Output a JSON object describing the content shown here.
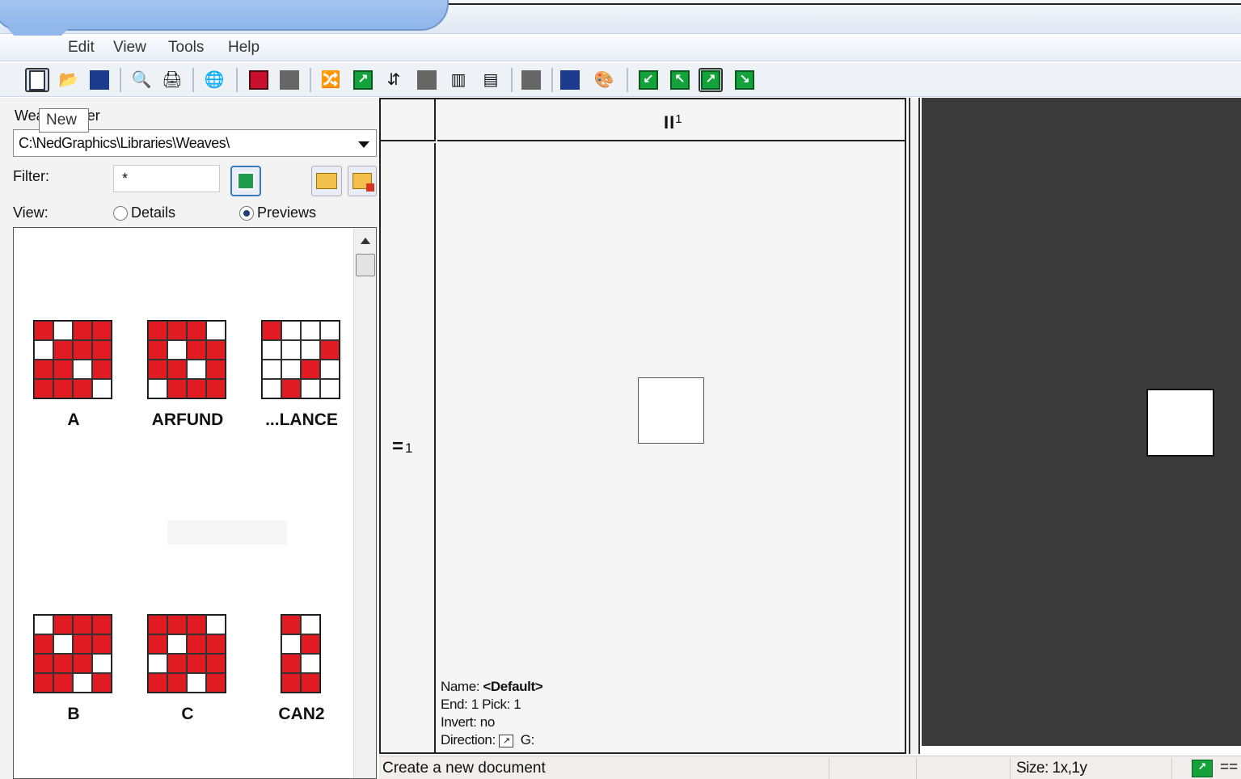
{
  "menu": [
    "Edit",
    "View",
    "Tools",
    "Help"
  ],
  "toolbar_icons": [
    "new-icon",
    "open-icon",
    "save-icon",
    "print-preview-icon",
    "print-icon",
    "web-icon",
    "grid-icon",
    "list-icon",
    "color-swap-icon",
    "arrow-icon",
    "scale-icon",
    "block-icon",
    "palette-icon",
    "column-icon",
    "copy-icon",
    "pattern-icon",
    "colors-icon",
    "direction-nw-icon",
    "direction-ne-icon",
    "direction-se-icon",
    "direction-sw-icon"
  ],
  "tooltip": "New",
  "left": {
    "folder_label": "Weave folder",
    "folder_path": "C:\\NedGraphics\\Libraries\\Weaves\\",
    "filter_label": "Filter:",
    "filter_value": "*",
    "view_label": "View:",
    "view_options": [
      "Details",
      "Previews"
    ],
    "view_selected": "Previews"
  },
  "weaves": [
    {
      "name": "A",
      "cells": [
        "r",
        "w",
        "r",
        "r",
        "w",
        "r",
        "r",
        "r",
        "r",
        "r",
        "w",
        "r",
        "r",
        "r",
        "r",
        "w"
      ]
    },
    {
      "name": "ARFUND",
      "cells": [
        "r",
        "r",
        "r",
        "w",
        "r",
        "w",
        "r",
        "r",
        "r",
        "r",
        "w",
        "r",
        "w",
        "r",
        "r",
        "r"
      ]
    },
    {
      "name": "...LANCE",
      "cells": [
        "r",
        "w",
        "w",
        "w",
        "w",
        "w",
        "w",
        "r",
        "w",
        "w",
        "r",
        "w",
        "w",
        "r",
        "w",
        "w"
      ]
    },
    {
      "name": "B",
      "cells": [
        "w",
        "r",
        "r",
        "r",
        "r",
        "w",
        "r",
        "r",
        "r",
        "r",
        "r",
        "w",
        "r",
        "r",
        "w",
        "r"
      ]
    },
    {
      "name": "C",
      "cells": [
        "r",
        "r",
        "r",
        "w",
        "r",
        "w",
        "r",
        "r",
        "w",
        "r",
        "r",
        "r",
        "r",
        "r",
        "w",
        "r"
      ]
    },
    {
      "name": "CAN2",
      "cells": [
        "r",
        "w",
        "w",
        "r",
        "r",
        "w",
        "r",
        "r"
      ]
    }
  ],
  "editor": {
    "column_label": "II",
    "column_number": "1",
    "row_label": "=",
    "row_number": "1",
    "info": {
      "name_label": "Name:",
      "name_value": "<Default>",
      "end_line": "End: 1 Pick: 1",
      "invert_line": "Invert: no",
      "direction_label": "Direction:",
      "g_label": "G:"
    }
  },
  "status": {
    "message": "Create a new document",
    "size": "Size: 1x,1y",
    "extra": "=="
  },
  "colors": {
    "weave_red": "#e01b22",
    "dark_panel": "#3b3b3b"
  }
}
